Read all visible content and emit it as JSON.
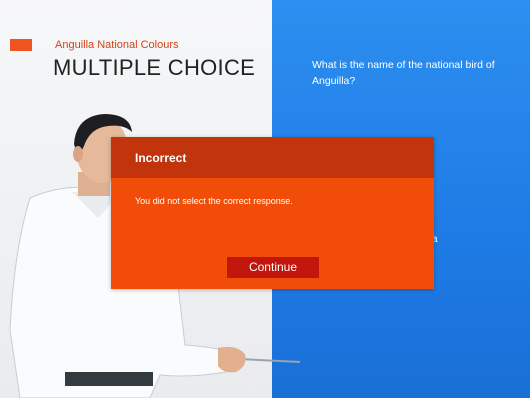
{
  "header": {
    "subtitle": "Anguilla National Colours",
    "title": "MULTIPLE CHOICE"
  },
  "question": {
    "text": "What is the name of the  national bird of Anguilla?",
    "peek_text": "a"
  },
  "dialog": {
    "title": "Incorrect",
    "message": "You did not select the correct response.",
    "button_label": "Continue"
  },
  "colors": {
    "accent": "#ee5522",
    "panel_blue": "#2389ea",
    "dialog_body": "#f14d09",
    "dialog_header": "#c2350c",
    "button": "#c2150c"
  }
}
